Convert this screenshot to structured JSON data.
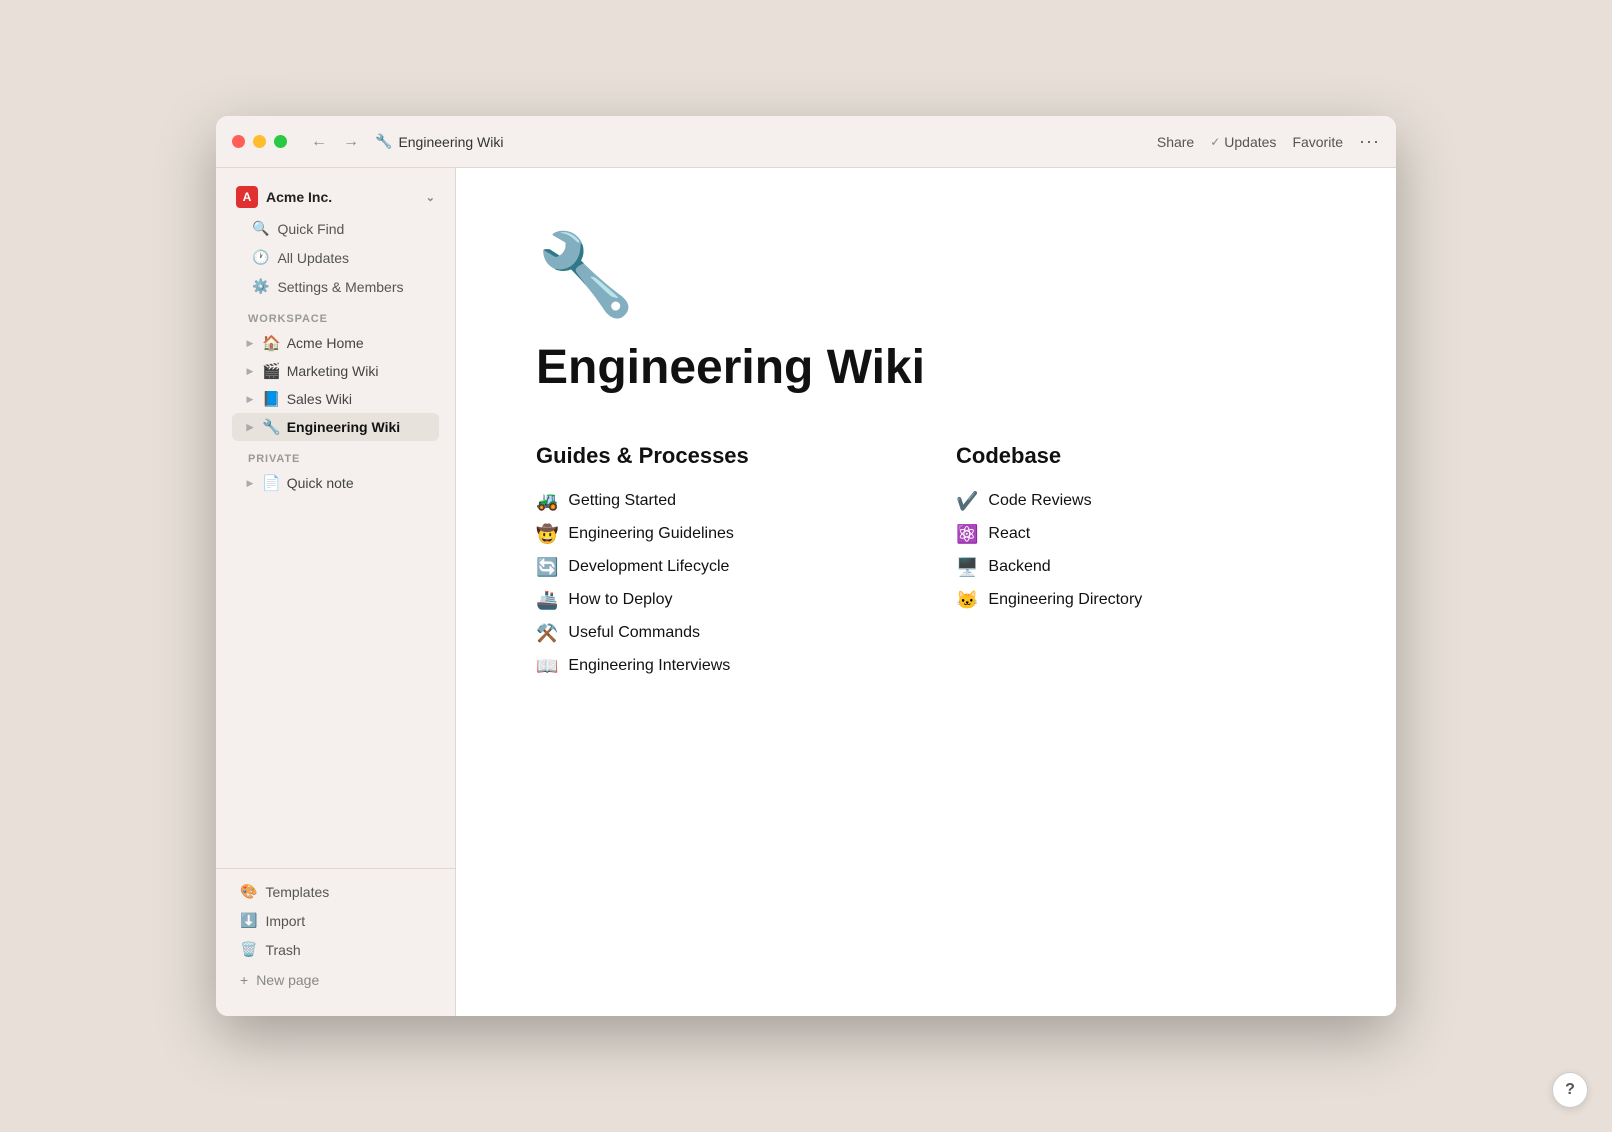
{
  "app": {
    "title": "Engineering Wiki"
  },
  "titlebar": {
    "back_label": "←",
    "forward_label": "→",
    "page_icon": "🔧",
    "page_title": "Engineering Wiki",
    "share_label": "Share",
    "updates_label": "Updates",
    "updates_icon": "✓",
    "favorite_label": "Favorite",
    "more_label": "···"
  },
  "sidebar": {
    "workspace_name": "Acme Inc.",
    "workspace_logo": "A",
    "nav_items": [
      {
        "id": "quick-find",
        "icon": "🔍",
        "label": "Quick Find"
      },
      {
        "id": "all-updates",
        "icon": "🕐",
        "label": "All Updates"
      },
      {
        "id": "settings",
        "icon": "⚙️",
        "label": "Settings & Members"
      }
    ],
    "workspace_section": "WORKSPACE",
    "workspace_pages": [
      {
        "id": "acme-home",
        "icon": "🏠",
        "label": "Acme Home",
        "active": false
      },
      {
        "id": "marketing-wiki",
        "icon": "🎬",
        "label": "Marketing Wiki",
        "active": false
      },
      {
        "id": "sales-wiki",
        "icon": "📘",
        "label": "Sales Wiki",
        "active": false
      },
      {
        "id": "engineering-wiki",
        "icon": "🔧",
        "label": "Engineering Wiki",
        "active": true
      }
    ],
    "private_section": "PRIVATE",
    "private_pages": [
      {
        "id": "quick-note",
        "icon": "📄",
        "label": "Quick note",
        "active": false
      }
    ],
    "bottom_items": [
      {
        "id": "templates",
        "icon": "🎨",
        "label": "Templates"
      },
      {
        "id": "import",
        "icon": "⬇️",
        "label": "Import"
      },
      {
        "id": "trash",
        "icon": "🗑️",
        "label": "Trash"
      }
    ],
    "new_page_label": "+ New page"
  },
  "page": {
    "emoji": "🔧",
    "title": "Engineering Wiki",
    "sections": [
      {
        "id": "guides",
        "heading": "Guides & Processes",
        "links": [
          {
            "id": "getting-started",
            "icon": "🚜",
            "label": "Getting Started"
          },
          {
            "id": "engineering-guidelines",
            "icon": "🤠",
            "label": "Engineering Guidelines"
          },
          {
            "id": "development-lifecycle",
            "icon": "🔄",
            "label": "Development Lifecycle"
          },
          {
            "id": "how-to-deploy",
            "icon": "🚢",
            "label": "How to Deploy"
          },
          {
            "id": "useful-commands",
            "icon": "⚒️",
            "label": "Useful Commands"
          },
          {
            "id": "engineering-interviews",
            "icon": "📖",
            "label": "Engineering Interviews"
          }
        ]
      },
      {
        "id": "codebase",
        "heading": "Codebase",
        "links": [
          {
            "id": "code-reviews",
            "icon": "✔️",
            "label": "Code Reviews"
          },
          {
            "id": "react",
            "icon": "⚛️",
            "label": "React"
          },
          {
            "id": "backend",
            "icon": "🖥️",
            "label": "Backend"
          },
          {
            "id": "engineering-directory",
            "icon": "🐱",
            "label": "Engineering Directory"
          }
        ]
      }
    ]
  },
  "help": {
    "label": "?"
  }
}
